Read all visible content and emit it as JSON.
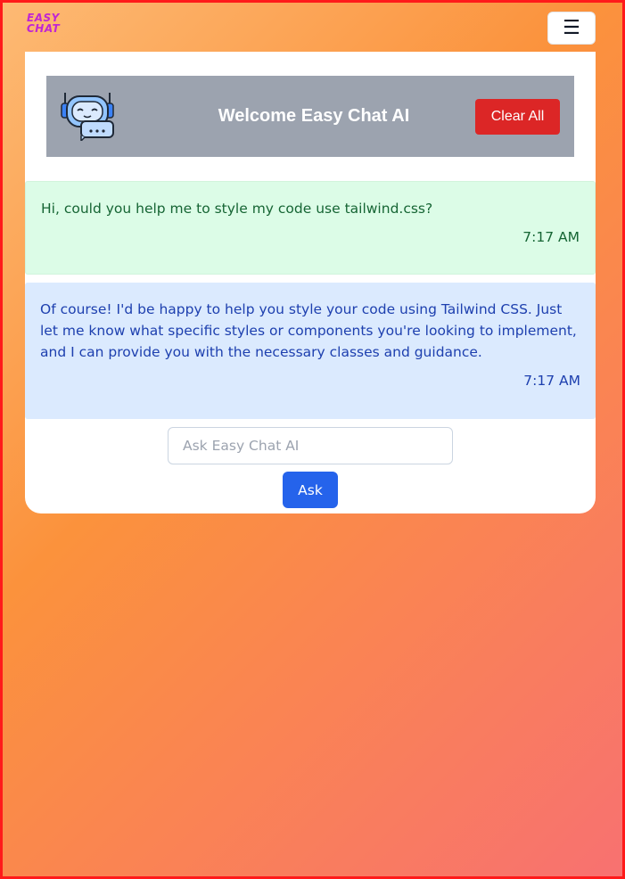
{
  "brand": {
    "line1": "EASY",
    "line2": "CHAT"
  },
  "menu": {
    "icon_glyph": "☰",
    "icon_name": "hamburger-menu-icon"
  },
  "header": {
    "title": "Welcome Easy Chat AI",
    "clear_label": "Clear All",
    "icon_name": "robot-chat-icon"
  },
  "messages": [
    {
      "role": "user",
      "text": "Hi, could you help me to style my code use tailwind.css?",
      "time": "7:17 AM"
    },
    {
      "role": "assistant",
      "text": "Of course! I'd be happy to help you style your code using Tailwind CSS. Just let me know what specific styles or components you're looking to implement, and I can provide you with the necessary classes and guidance.",
      "time": "7:17 AM"
    }
  ],
  "composer": {
    "placeholder": "Ask Easy Chat AI",
    "value": "",
    "button_label": "Ask"
  },
  "colors": {
    "brand": "#c026d3",
    "clear_button": "#dc2626",
    "ask_button": "#2563eb",
    "user_bubble": "#dcfce7",
    "assistant_bubble": "#dbeafe",
    "header_bg": "#9ca3af"
  }
}
